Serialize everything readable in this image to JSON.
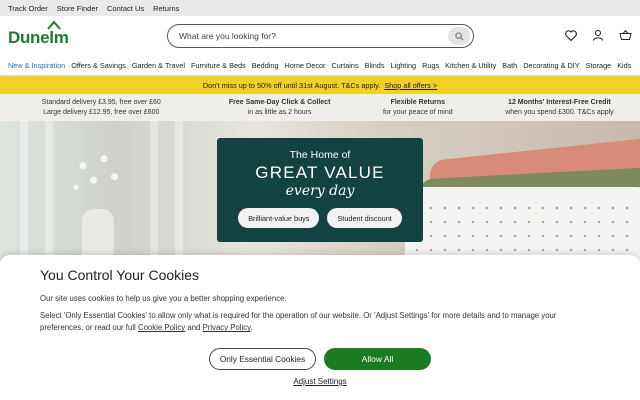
{
  "topbar": {
    "links": [
      "Track Order",
      "Store Finder",
      "Contact Us",
      "Returns"
    ]
  },
  "header": {
    "logo": "Dunelm",
    "search_placeholder": "What are you looking for?",
    "icons": [
      "heart-icon",
      "account-icon",
      "basket-icon"
    ]
  },
  "nav": {
    "items": [
      "New & Inspiration",
      "Offers & Savings",
      "Garden & Travel",
      "Furniture & Beds",
      "Bedding",
      "Home Decor",
      "Curtains",
      "Blinds",
      "Lighting",
      "Rugs",
      "Kitchen & Utility",
      "Bath",
      "Decorating & DIY",
      "Storage",
      "Kids"
    ],
    "active_color": "#1d6fb8"
  },
  "promo": {
    "text": "Don't miss up to 50% off until 31st August. T&Cs apply.",
    "link": "Shop all offers >",
    "color": "#f3cf2a"
  },
  "usps": [
    {
      "line1": "Standard delivery £3.95, free over £60",
      "line2": "Large delivery £12.95, free over £600"
    },
    {
      "line1": "Free Same-Day Click & Collect",
      "line2": "in as little as 2 hours"
    },
    {
      "line1": "Flexible Returns",
      "line2": "for your peace of mind"
    },
    {
      "line1": "12 Months' Interest-Free Credit",
      "line2": "when you spend £300. T&Cs apply"
    }
  ],
  "hero": {
    "pre": "The Home of",
    "main": "GREAT VALUE",
    "sub": "every day",
    "buttons": [
      "Brilliant-value buys",
      "Student discount"
    ],
    "card_color": "#124340"
  },
  "cookie": {
    "title": "You Control Your Cookies",
    "p1": "Our site uses cookies to help us give you a better shopping experience.",
    "p2_a": "Select 'Only Essential Cookies' to allow only what is required for the operation of our website. Or 'Adjust Settings' for more details and to manage your preferences, or read our full ",
    "p2_link1": "Cookie Policy",
    "p2_and": " and ",
    "p2_link2": "Privacy Policy",
    "p2_end": ".",
    "btn_essential": "Only Essential Cookies",
    "btn_allow": "Allow All",
    "adjust": "Adjust Settings",
    "allow_color": "#1c7a22"
  }
}
